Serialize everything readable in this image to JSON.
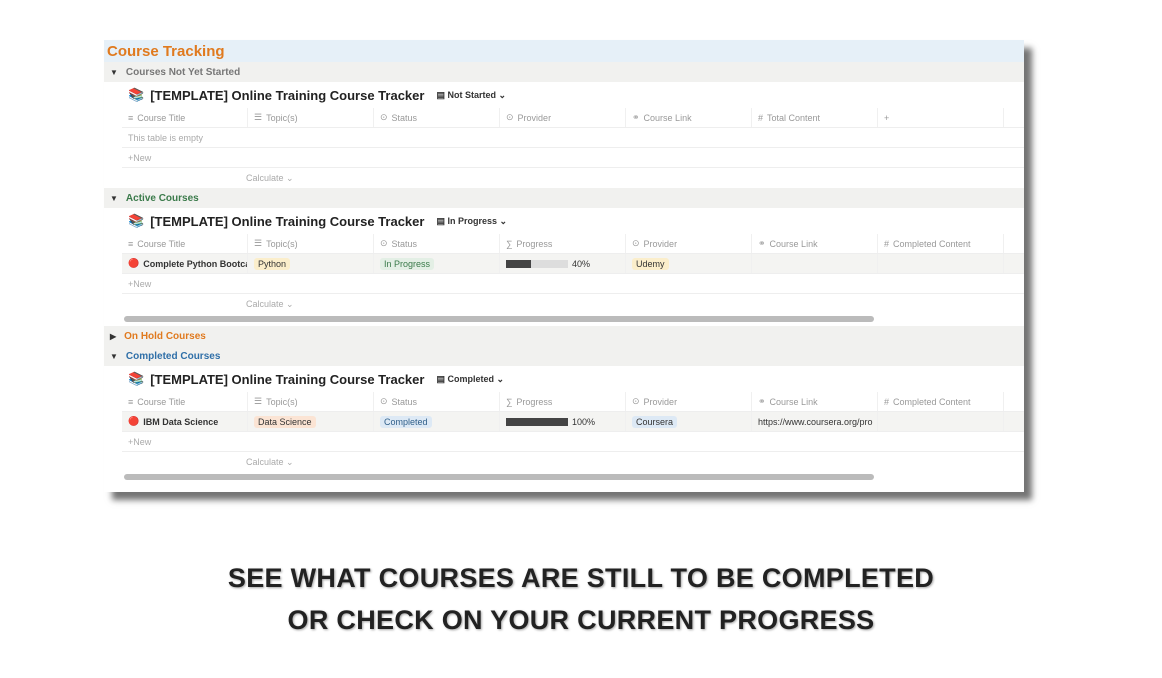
{
  "title": "Course Tracking",
  "sections": [
    {
      "label": "Courses Not Yet Started",
      "color": "#777",
      "expanded": true,
      "db_title": "[TEMPLATE] Online Training Course Tracker",
      "view": "Not Started",
      "columns": [
        "Course Title",
        "Topic(s)",
        "Status",
        "Provider",
        "Course Link",
        "Total Content",
        ""
      ],
      "column_icons": [
        "text-icon",
        "list-icon",
        "status-icon",
        "status-icon",
        "link-icon",
        "hash-icon",
        "plus-icon"
      ],
      "empty_text": "This table is empty",
      "rows": [],
      "new_label": "New",
      "calculate_label": "Calculate",
      "scroll": false
    },
    {
      "label": "Active Courses",
      "color": "#3a7a4a",
      "expanded": true,
      "db_title": "[TEMPLATE] Online Training Course Tracker",
      "view": "In Progress",
      "columns": [
        "Course Title",
        "Topic(s)",
        "Status",
        "Progress",
        "Provider",
        "Course Link",
        "Completed Content"
      ],
      "column_icons": [
        "text-icon",
        "list-icon",
        "status-icon",
        "sigma-icon",
        "status-icon",
        "link-icon",
        "hash-icon"
      ],
      "rows": [
        {
          "title": "Complete Python Bootcamp: Go from",
          "topic": "Python",
          "topic_color": "#fbeecb",
          "status": "In Progress",
          "status_color": "#e3efe5",
          "status_text_color": "#3a7a4a",
          "progress": 40,
          "progress_label": "40%",
          "provider": "Udemy",
          "provider_color": "#fbeecb",
          "link": ""
        }
      ],
      "new_label": "New",
      "calculate_label": "Calculate",
      "scroll": true
    },
    {
      "label": "On Hold Courses",
      "color": "#e07a1f",
      "expanded": false
    },
    {
      "label": "Completed Courses",
      "color": "#2f6fa8",
      "expanded": true,
      "db_title": "[TEMPLATE] Online Training Course Tracker",
      "view": "Completed",
      "columns": [
        "Course Title",
        "Topic(s)",
        "Status",
        "Progress",
        "Provider",
        "Course Link",
        "Completed Content"
      ],
      "column_icons": [
        "text-icon",
        "list-icon",
        "status-icon",
        "sigma-icon",
        "status-icon",
        "link-icon",
        "hash-icon"
      ],
      "rows": [
        {
          "title": "IBM Data Science",
          "topic": "Data Science",
          "topic_color": "#fbe4d4",
          "status": "Completed",
          "status_color": "#dde9f5",
          "status_text_color": "#2f5f8a",
          "progress": 100,
          "progress_label": "100%",
          "provider": "Coursera",
          "provider_color": "#dde9f5",
          "link": "https://www.coursera.org/pro"
        }
      ],
      "new_label": "New",
      "calculate_label": "Calculate",
      "scroll": true
    }
  ],
  "caption": {
    "line1": "SEE WHAT COURSES ARE STILL TO BE COMPLETED",
    "line2": "OR CHECK ON YOUR CURRENT PROGRESS"
  }
}
